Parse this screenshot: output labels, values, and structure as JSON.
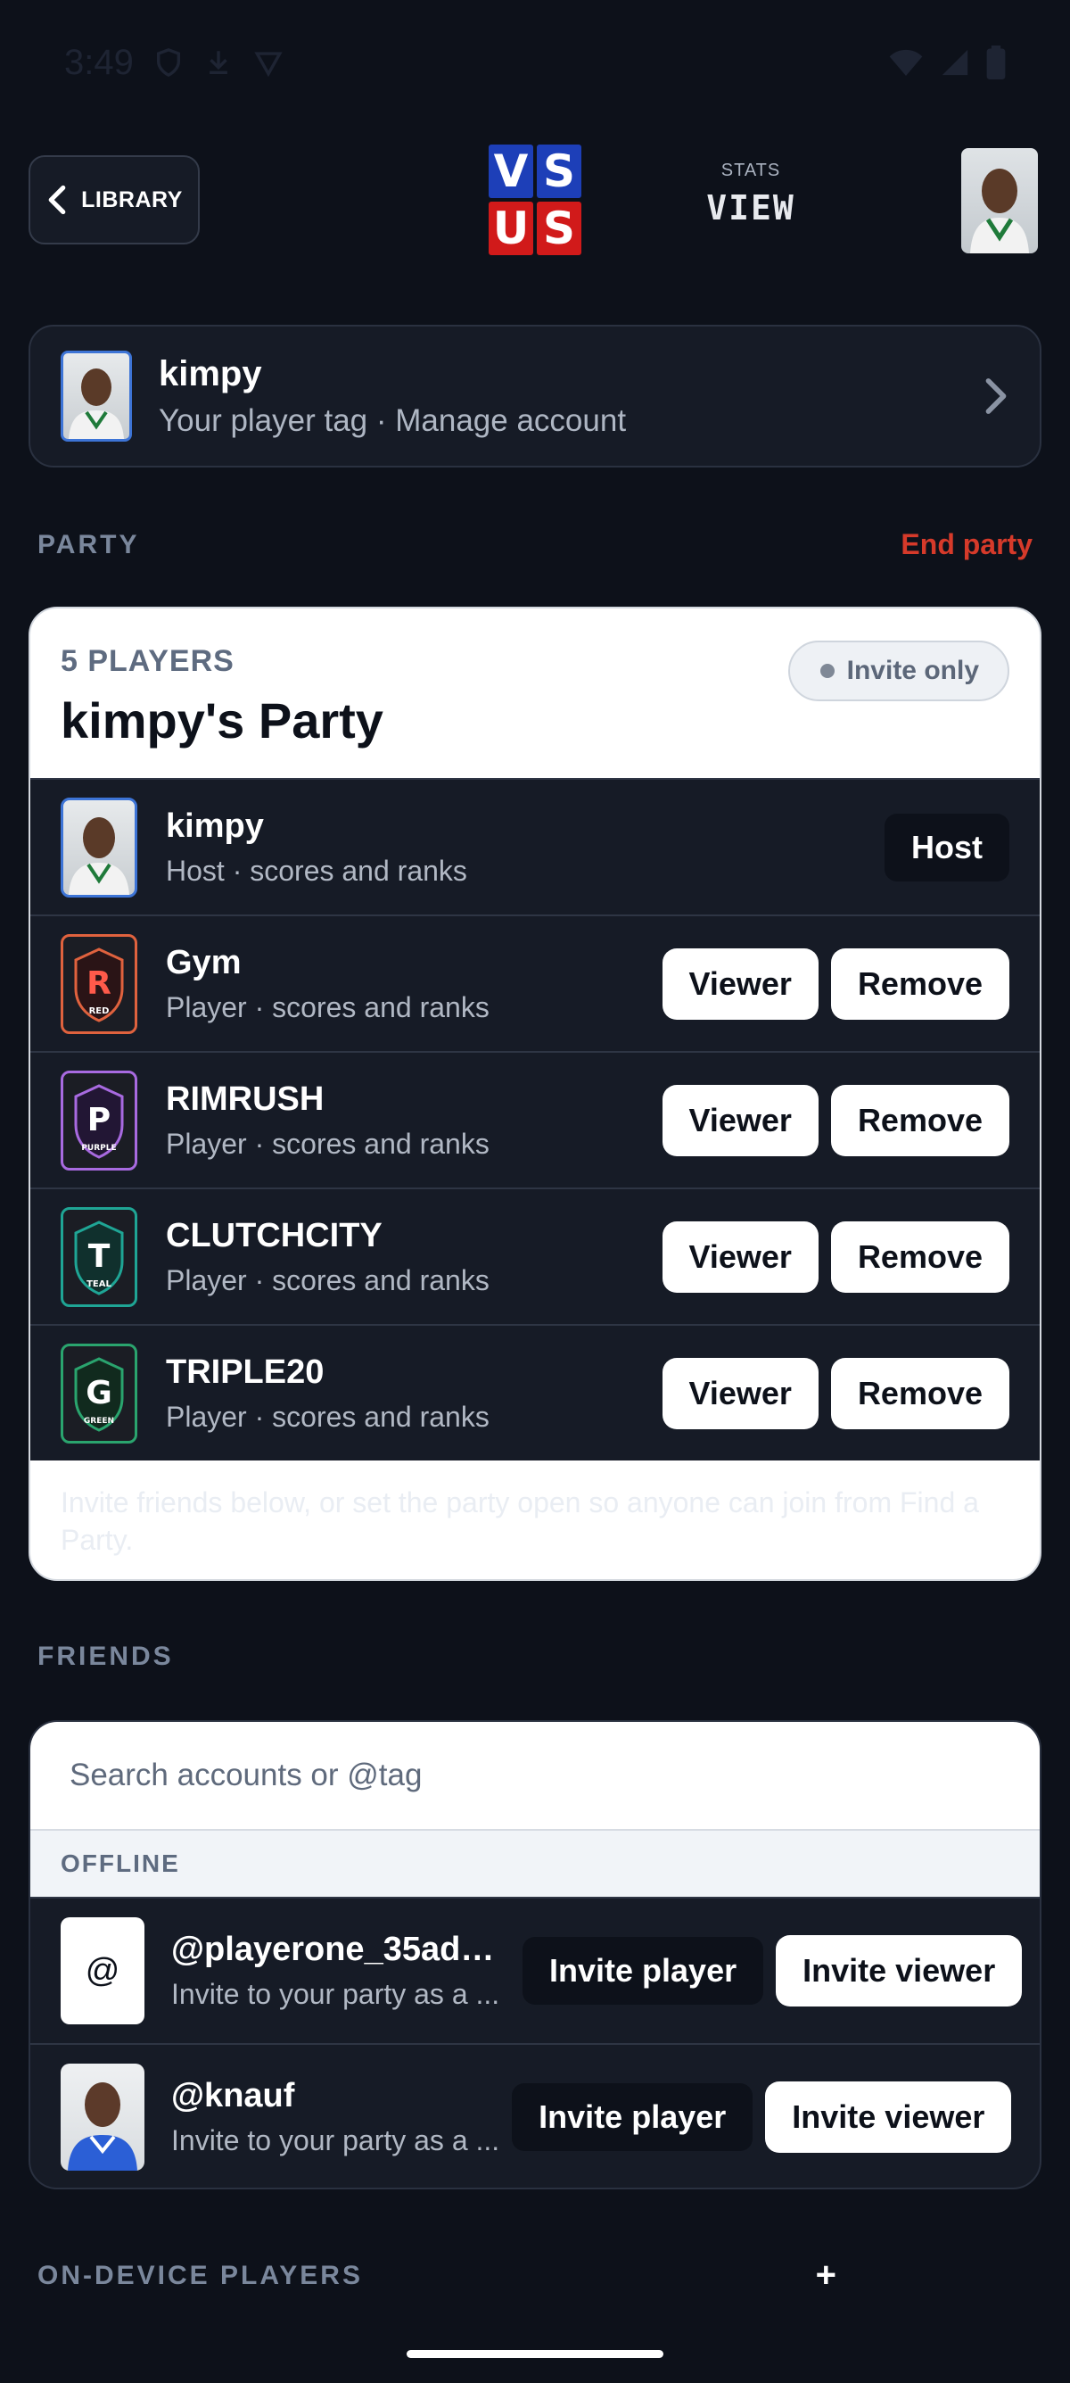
{
  "status_bar": {
    "time": "3:49"
  },
  "header": {
    "back_label": "LIBRARY",
    "logo": [
      "V",
      "S",
      "U",
      "S"
    ],
    "stats_label": "STATS",
    "view_label": "VIEW"
  },
  "account": {
    "name": "kimpy",
    "subtitle": "Your player tag · Manage account"
  },
  "party_section": {
    "title": "PARTY",
    "end_label": "End party"
  },
  "party": {
    "count_label": "5 PLAYERS",
    "name": "kimpy's Party",
    "visibility": "Invite only",
    "members": [
      {
        "name": "kimpy",
        "subtitle": "Host · scores and ranks",
        "role_label": "Host"
      },
      {
        "name": "Gym",
        "subtitle": "Player · scores and ranks",
        "badge_letter": "R",
        "badge_word": "RED",
        "color": "#e0623e",
        "viewer_label": "Viewer",
        "remove_label": "Remove"
      },
      {
        "name": "RIMRUSH",
        "subtitle": "Player · scores and ranks",
        "badge_letter": "P",
        "badge_word": "PURPLE",
        "color": "#a86ae0",
        "viewer_label": "Viewer",
        "remove_label": "Remove"
      },
      {
        "name": "CLUTCHCITY",
        "subtitle": "Player · scores and ranks",
        "badge_letter": "T",
        "badge_word": "TEAL",
        "color": "#1fa595",
        "viewer_label": "Viewer",
        "remove_label": "Remove"
      },
      {
        "name": "TRIPLE20",
        "subtitle": "Player · scores and ranks",
        "badge_letter": "G",
        "badge_word": "GREEN",
        "color": "#2aa46e",
        "viewer_label": "Viewer",
        "remove_label": "Remove"
      }
    ],
    "footer_text": "Invite friends below, or set the party open so anyone can join from Find a Party."
  },
  "friends_section": {
    "title": "FRIENDS"
  },
  "friends": {
    "search_placeholder": "Search accounts or @tag",
    "offline_label": "OFFLINE",
    "list": [
      {
        "avatar_text": "@",
        "name": "@playerone_35adda...",
        "subtitle": "Invite to your party as a ...",
        "invite_player_label": "Invite player",
        "invite_viewer_label": "Invite viewer"
      },
      {
        "name": "@knauf",
        "subtitle": "Invite to your party as a ...",
        "invite_player_label": "Invite player",
        "invite_viewer_label": "Invite viewer"
      }
    ]
  },
  "ondevice_section": {
    "title": "ON-DEVICE PLAYERS",
    "add_label": "+"
  },
  "colors": {
    "background": "#0d111a",
    "card": "#161b26",
    "danger": "#d63a2a",
    "host_blue": "#3d74d6"
  }
}
